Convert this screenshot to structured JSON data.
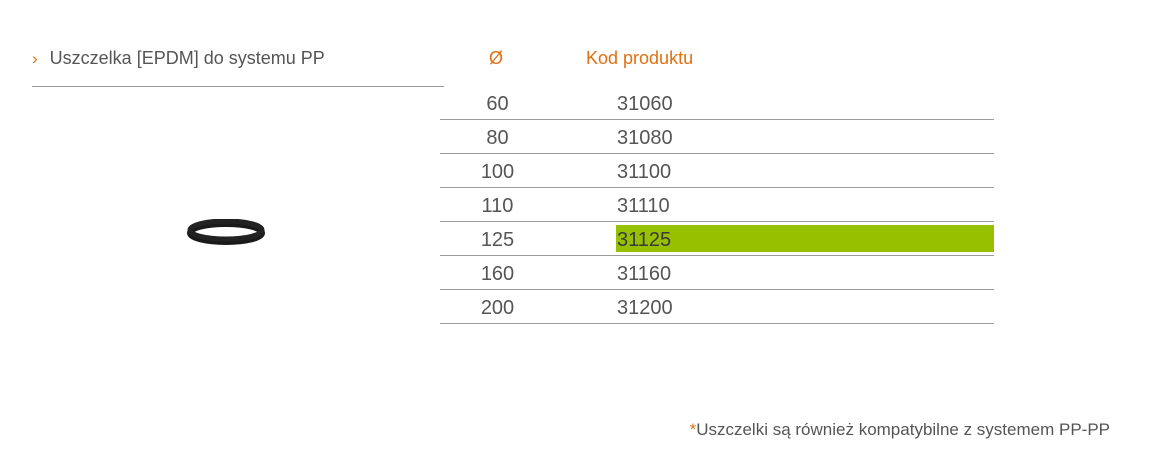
{
  "product": {
    "chevron": "›",
    "name": "Uszczelka [EPDM] do systemu PP"
  },
  "table": {
    "diameter_header": "Ø",
    "code_header": "Kod produktu",
    "rows": [
      {
        "diameter": "60",
        "code": "31060"
      },
      {
        "diameter": "80",
        "code": "31080"
      },
      {
        "diameter": "100",
        "code": "31100"
      },
      {
        "diameter": "110",
        "code": "31110"
      },
      {
        "diameter": "125",
        "code": "31125"
      },
      {
        "diameter": "160",
        "code": "31160"
      },
      {
        "diameter": "200",
        "code": "31200"
      }
    ]
  },
  "image": {
    "icon": "gasket-ring-icon"
  },
  "footnote": {
    "marker": "*",
    "text": "Uszczelki są również kompatybilne z systemem PP-PP"
  },
  "colors": {
    "accent": "#e07010",
    "highlight": "#97c000",
    "text": "#555555",
    "rule": "#9a9a9a"
  }
}
